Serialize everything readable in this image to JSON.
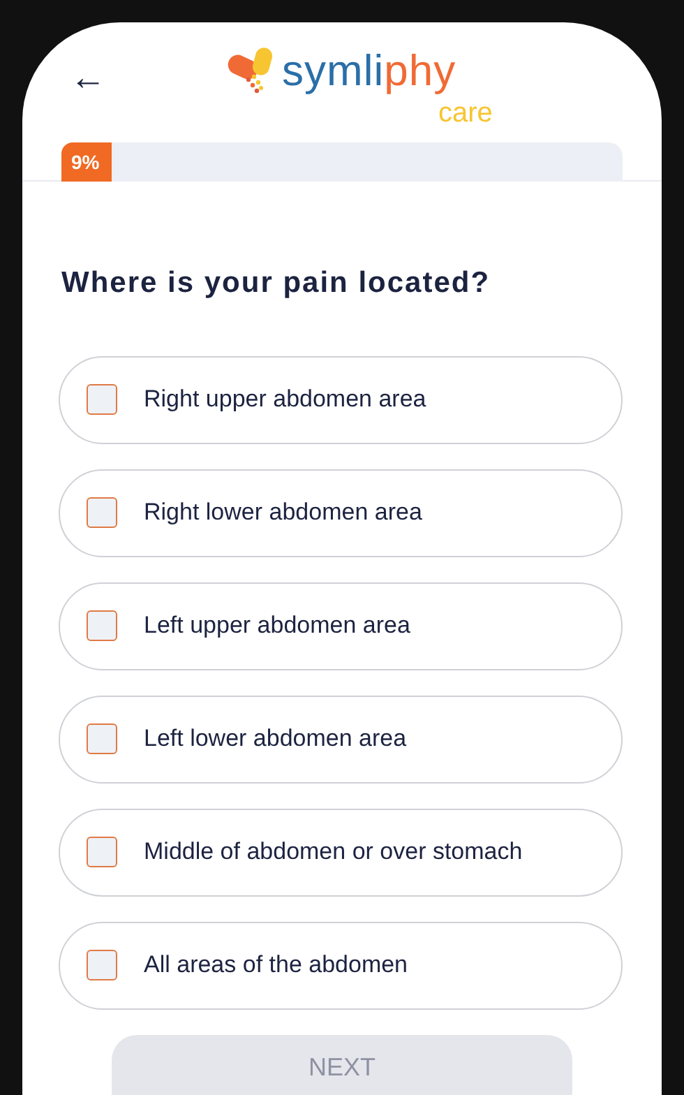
{
  "header": {
    "back_icon": "←",
    "logo": {
      "parts": [
        {
          "text": "symli",
          "color": "#2a6fa8"
        },
        {
          "text": "phy",
          "color": "#f06a35"
        }
      ],
      "tagline": "care"
    }
  },
  "progress": {
    "label": "9%",
    "level": 0.09
  },
  "question": "Where is your pain located?",
  "options": [
    {
      "label": "Right upper abdomen area",
      "checked": false
    },
    {
      "label": "Right lower abdomen area",
      "checked": false
    },
    {
      "label": "Left upper abdomen area",
      "checked": false
    },
    {
      "label": "Left lower abdomen area",
      "checked": false
    },
    {
      "label": "Middle of abdomen or over stomach",
      "checked": false
    },
    {
      "label": "All areas of the abdomen",
      "checked": false
    }
  ],
  "next_button": {
    "label": "NEXT",
    "disabled": true
  }
}
